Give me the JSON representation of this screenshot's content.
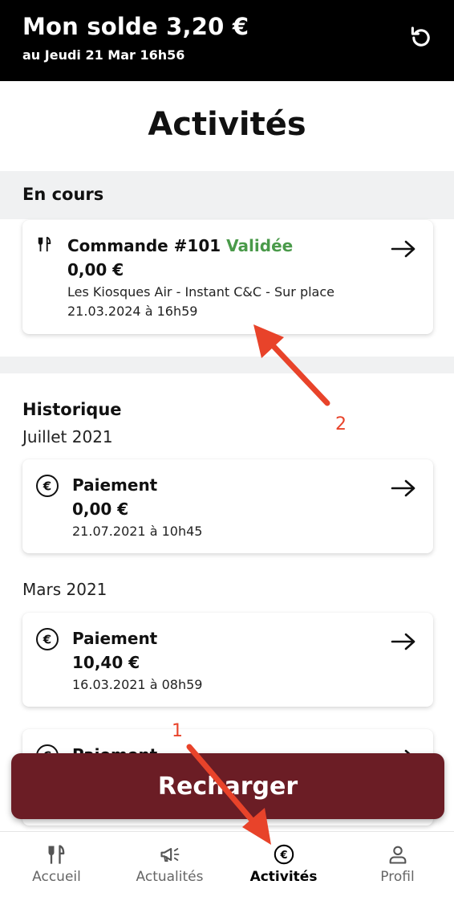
{
  "header": {
    "balance": "Mon solde 3,20 €",
    "date": "au Jeudi 21 Mar 16h56"
  },
  "page_title": "Activités",
  "current": {
    "section_label": "En cours",
    "order": {
      "title": "Commande #101",
      "status": "Validée",
      "status_color": "#4a9a4a",
      "amount": "0,00 €",
      "location": "Les Kiosques Air - Instant C&C - Sur place",
      "datetime": "21.03.2024 à 16h59"
    }
  },
  "history": {
    "section_label": "Historique",
    "groups": [
      {
        "month": "Juillet 2021",
        "items": [
          {
            "title": "Paiement",
            "amount": "0,00 €",
            "datetime": "21.07.2021 à 10h45"
          }
        ]
      },
      {
        "month": "Mars 2021",
        "items": [
          {
            "title": "Paiement",
            "amount": "10,40 €",
            "datetime": "16.03.2021 à 08h59"
          },
          {
            "title": "Paiement"
          }
        ]
      }
    ]
  },
  "recharge_button": "Recharger",
  "brand_color": "#6b1d25",
  "nav": [
    {
      "label": "Accueil",
      "icon": "cutlery-icon",
      "active": false
    },
    {
      "label": "Actualités",
      "icon": "megaphone-icon",
      "active": false
    },
    {
      "label": "Activités",
      "icon": "euro-circle-icon",
      "active": true
    },
    {
      "label": "Profil",
      "icon": "user-icon",
      "active": false
    }
  ],
  "annotations": [
    {
      "label": "1",
      "color": "#e8432a"
    },
    {
      "label": "2",
      "color": "#e8432a"
    }
  ]
}
